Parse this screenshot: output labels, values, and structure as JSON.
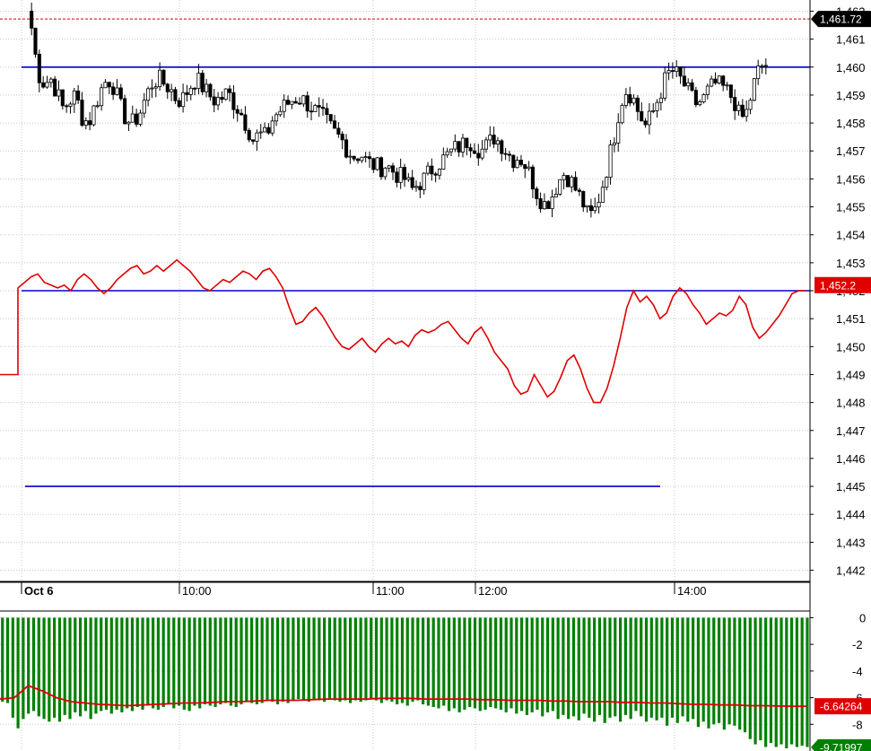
{
  "chart_data": [
    {
      "type": "candlestick",
      "name": "",
      "y_ticks": [
        "1,442",
        "1,443",
        "1,444",
        "1,445",
        "1,446",
        "1,447",
        "1,448",
        "1,449",
        "1,450",
        "1,451",
        "1,452",
        "1,453",
        "1,454",
        "1,455",
        "1,456",
        "1,457",
        "1,458",
        "1,459",
        "1,460",
        "1,461",
        "1,462"
      ],
      "ylim": [
        1441.6,
        1462.4
      ],
      "x_ticks": [
        {
          "label": "Oct 6",
          "time": "09:30",
          "bold": true
        },
        {
          "label": "10:00",
          "time": "10:00",
          "bold": false
        },
        {
          "label": "11:00",
          "time": "11:00",
          "bold": false
        },
        {
          "label": "12:00",
          "time": "12:00",
          "bold": false
        },
        {
          "label": "14:00",
          "time": "14:00",
          "bold": false
        }
      ],
      "last_price": {
        "label": "1,461.72",
        "value": 1461.72,
        "color": "#000000"
      },
      "red_line_value": {
        "label": "1,452.2",
        "value": 1452.2,
        "color": "#e00000"
      },
      "horizontal_levels": [
        {
          "value": 1460.0,
          "color": "#0000cc"
        },
        {
          "value": 1452.0,
          "color": "#0000cc"
        },
        {
          "value": 1445.0,
          "color": "#0000cc"
        },
        {
          "value": 1461.72,
          "color": "#cc0000",
          "style": "dashed"
        }
      ],
      "price_path": [
        1461.4,
        1459.8,
        1459.4,
        1459.6,
        1459.1,
        1458.5,
        1458.8,
        1459.0,
        1458.2,
        1458.0,
        1458.6,
        1459.2,
        1459.6,
        1459.3,
        1458.6,
        1458.1,
        1458.0,
        1458.3,
        1458.9,
        1459.4,
        1459.6,
        1459.4,
        1459.2,
        1458.8,
        1458.9,
        1459.3,
        1459.6,
        1459.3,
        1459.0,
        1458.8,
        1458.9,
        1459.1,
        1458.7,
        1458.4,
        1457.9,
        1457.4,
        1457.6,
        1457.5,
        1458.1,
        1458.4,
        1458.6,
        1458.8,
        1458.9,
        1458.8,
        1458.6,
        1458.4,
        1458.2,
        1457.9,
        1457.6,
        1457.4,
        1457.0,
        1456.8,
        1456.9,
        1456.6,
        1456.5,
        1456.4,
        1456.5,
        1456.3,
        1456.1,
        1456.0,
        1455.6,
        1455.8,
        1456.0,
        1456.3,
        1456.5,
        1456.7,
        1456.9,
        1457.1,
        1457.2,
        1457.4,
        1457.2,
        1457.0,
        1457.2,
        1457.5,
        1457.3,
        1457.0,
        1456.7,
        1456.8,
        1456.5,
        1456.0,
        1455.4,
        1455.1,
        1455.3,
        1455.8,
        1456.2,
        1456.0,
        1455.6,
        1455.2,
        1454.6,
        1454.9,
        1455.6,
        1456.5,
        1457.5,
        1458.7,
        1459.2,
        1458.9,
        1458.3,
        1457.9,
        1458.3,
        1458.9,
        1459.5,
        1459.9,
        1459.7,
        1459.4,
        1459.0,
        1458.7,
        1458.8,
        1459.2,
        1459.4,
        1459.3,
        1459.1,
        1458.8,
        1458.1,
        1458.4,
        1459.3,
        1460.0,
        1460.1
      ]
    },
    {
      "type": "line",
      "name": "",
      "color": "#e00000",
      "values": [
        1449.0,
        1449.0,
        1452.1,
        1452.3,
        1452.5,
        1452.6,
        1452.3,
        1452.2,
        1452.1,
        1452.2,
        1452.0,
        1452.4,
        1452.6,
        1452.4,
        1452.1,
        1451.9,
        1452.1,
        1452.4,
        1452.6,
        1452.8,
        1452.9,
        1452.6,
        1452.7,
        1452.9,
        1452.7,
        1452.9,
        1453.1,
        1452.9,
        1452.7,
        1452.4,
        1452.1,
        1452.0,
        1452.2,
        1452.4,
        1452.3,
        1452.5,
        1452.7,
        1452.6,
        1452.4,
        1452.7,
        1452.8,
        1452.5,
        1452.1,
        1451.4,
        1450.8,
        1450.9,
        1451.2,
        1451.4,
        1451.1,
        1450.7,
        1450.3,
        1450.0,
        1449.9,
        1450.1,
        1450.3,
        1450.0,
        1449.8,
        1450.1,
        1450.3,
        1450.1,
        1450.2,
        1450.0,
        1450.4,
        1450.6,
        1450.5,
        1450.6,
        1450.8,
        1450.9,
        1450.6,
        1450.3,
        1450.1,
        1450.5,
        1450.7,
        1450.3,
        1449.8,
        1449.5,
        1449.2,
        1448.6,
        1448.3,
        1448.4,
        1449.0,
        1448.6,
        1448.2,
        1448.4,
        1448.9,
        1449.5,
        1449.7,
        1449.2,
        1448.5,
        1448.0,
        1448.0,
        1448.5,
        1449.3,
        1450.3,
        1451.4,
        1452.0,
        1451.6,
        1451.8,
        1451.5,
        1451.0,
        1451.2,
        1451.8,
        1452.1,
        1451.9,
        1451.5,
        1451.2,
        1450.8,
        1451.0,
        1451.2,
        1451.1,
        1451.3,
        1451.8,
        1451.5,
        1450.7,
        1450.3,
        1450.5,
        1450.8,
        1451.1,
        1451.5,
        1451.9,
        1452.0,
        1452.0
      ]
    },
    {
      "type": "bar",
      "name": "",
      "y_ticks": [
        "0",
        "-2",
        "-4",
        "-6",
        "-8"
      ],
      "ylim": [
        -10.0,
        0.5
      ],
      "bar_color": "#008000",
      "line_color": "#e00000",
      "line_value_tag": {
        "label": "-6.64264",
        "value": -6.64264,
        "color": "#e00000"
      },
      "bar_value_tag": {
        "label": "-9.71997",
        "value": -9.71997,
        "color": "#008000"
      },
      "bars": [
        -6.3,
        -6.4,
        -7.5,
        -8.3,
        -7.6,
        -7.2,
        -7.0,
        -7.4,
        -7.6,
        -7.8,
        -7.5,
        -7.8,
        -7.3,
        -7.6,
        -7.1,
        -7.4,
        -7.0,
        -7.6,
        -7.2,
        -7.0,
        -6.9,
        -7.2,
        -6.9,
        -7.1,
        -6.8,
        -7.0,
        -6.7,
        -6.9,
        -6.6,
        -6.8,
        -6.9,
        -6.7,
        -6.5,
        -6.8,
        -6.6,
        -6.9,
        -7.0,
        -6.6,
        -6.8,
        -6.5,
        -6.6,
        -6.7,
        -6.5,
        -6.4,
        -6.6,
        -6.7,
        -6.5,
        -6.3,
        -6.4,
        -6.5,
        -6.4,
        -6.2,
        -6.3,
        -6.5,
        -6.3,
        -6.4,
        -6.2,
        -6.1,
        -6.2,
        -6.3,
        -6.1,
        -6.2,
        -6.3,
        -6.1,
        -6.2,
        -6.3,
        -6.2,
        -6.4,
        -6.2,
        -6.3,
        -6.2,
        -6.1,
        -6.2,
        -6.4,
        -6.2,
        -6.3,
        -6.5,
        -6.4,
        -6.6,
        -6.3,
        -6.2,
        -6.5,
        -6.6,
        -6.7,
        -6.8,
        -6.6,
        -7.0,
        -6.8,
        -7.1,
        -6.9,
        -6.7,
        -6.8,
        -7.0,
        -6.9,
        -6.7,
        -6.8,
        -6.9,
        -7.1,
        -6.8,
        -7.2,
        -7.0,
        -7.3,
        -7.1,
        -6.9,
        -7.4,
        -7.1,
        -7.0,
        -7.6,
        -7.3,
        -7.6,
        -7.4,
        -7.7,
        -7.2,
        -7.5,
        -7.8,
        -7.3,
        -7.9,
        -7.5,
        -7.4,
        -7.8,
        -7.3,
        -7.6,
        -7.0,
        -7.4,
        -7.8,
        -7.5,
        -7.7,
        -7.5,
        -8.1,
        -7.5,
        -7.9,
        -7.4,
        -7.8,
        -7.6,
        -8.2,
        -7.8,
        -8.3,
        -8.0,
        -7.9,
        -8.4,
        -8.0,
        -8.1,
        -8.4,
        -8.6,
        -9.1,
        -9.5,
        -9.2,
        -9.7,
        -9.4,
        -9.7,
        -9.5,
        -9.8,
        -9.5,
        -9.7,
        -9.6,
        -9.7
      ],
      "line": [
        -6.1,
        -6.0,
        -5.1,
        -5.5,
        -6.0,
        -6.3,
        -6.4,
        -6.5,
        -6.55,
        -6.6,
        -6.55,
        -6.5,
        -6.45,
        -6.4,
        -6.4,
        -6.35,
        -6.3,
        -6.3,
        -6.25,
        -6.2,
        -6.2,
        -6.2,
        -6.15,
        -6.1,
        -6.1,
        -6.1,
        -6.1,
        -6.05,
        -6.05,
        -6.05,
        -6.1,
        -6.1,
        -6.1,
        -6.1,
        -6.15,
        -6.15,
        -6.2,
        -6.2,
        -6.2,
        -6.25,
        -6.25,
        -6.3,
        -6.3,
        -6.3,
        -6.35,
        -6.35,
        -6.4,
        -6.4,
        -6.45,
        -6.5,
        -6.5,
        -6.55,
        -6.55,
        -6.6,
        -6.6,
        -6.62,
        -6.64,
        -6.64
      ]
    }
  ]
}
